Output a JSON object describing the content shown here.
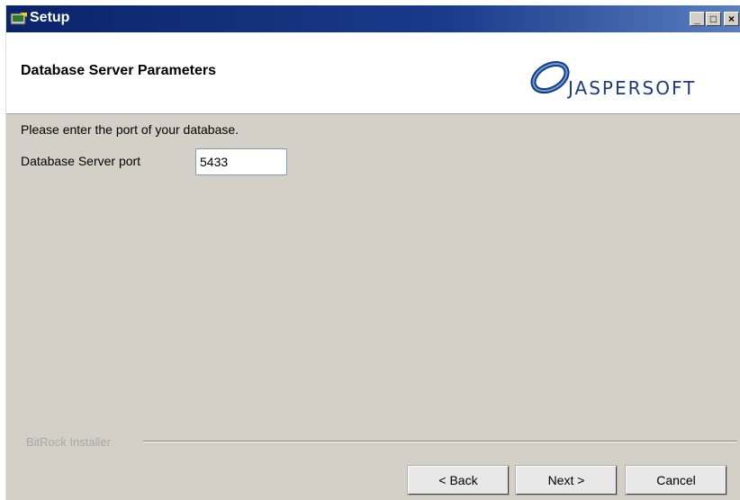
{
  "window": {
    "title": "Setup",
    "controls": {
      "minimize": "_",
      "maximize": "□",
      "close": "×"
    }
  },
  "header": {
    "title": "Database Server Parameters",
    "logo_text": "JASPERSOFT"
  },
  "form": {
    "instruction": "Please enter the port of your database.",
    "port_label": "Database Server port",
    "port_value": "5433"
  },
  "footer": {
    "brand": "BitRock Installer",
    "back_label": "< Back",
    "next_label": "Next >",
    "cancel_label": "Cancel"
  },
  "colors": {
    "titlebar": "#0a246a",
    "dialog_bg": "#d4d0c8",
    "logo_blue": "#1d3b7a"
  },
  "icons": [
    "setup-app-icon",
    "minimize-icon",
    "maximize-icon",
    "close-icon",
    "jaspersoft-logo"
  ]
}
